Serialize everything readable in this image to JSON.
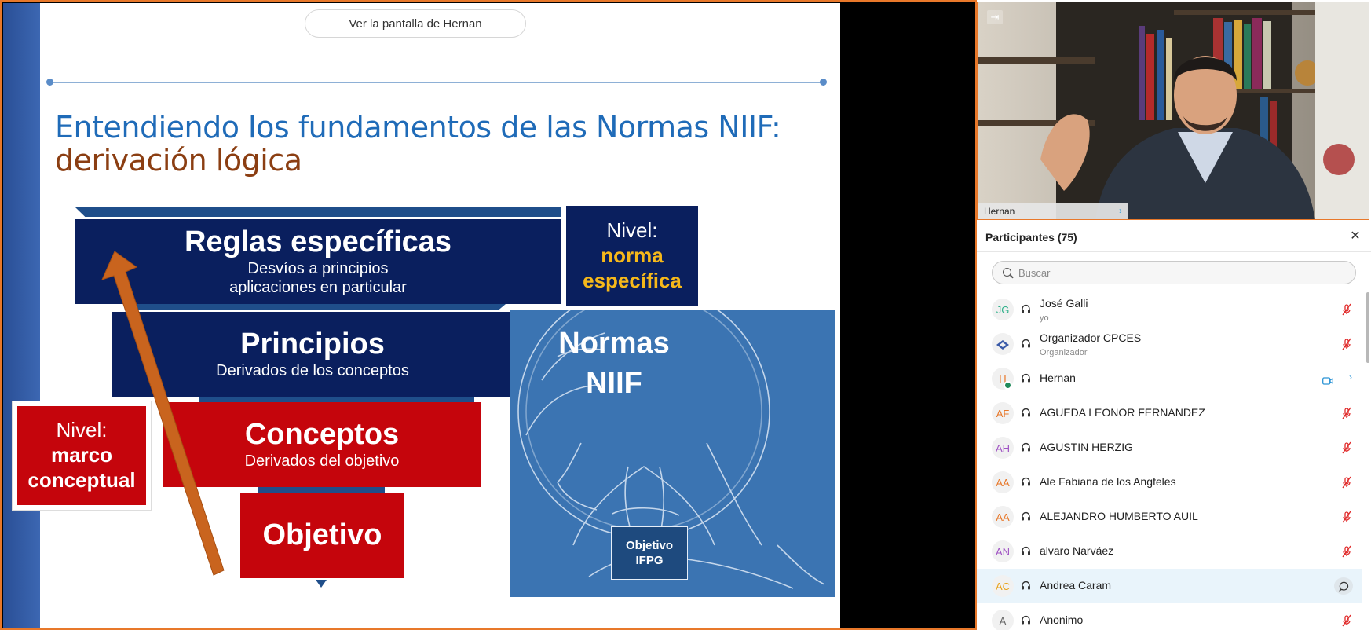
{
  "share": {
    "view_pill": "Ver la pantalla de Hernan"
  },
  "slide": {
    "title_line1": "Entendiendo los fundamentos de las Normas NIIF:",
    "title_line2": "derivación lógica",
    "reglas": {
      "title": "Reglas específicas",
      "sub1": "Desvíos a principios",
      "sub2": "aplicaciones en particular"
    },
    "principios": {
      "title": "Principios",
      "sub": "Derivados de los conceptos"
    },
    "conceptos": {
      "title": "Conceptos",
      "sub": "Derivados del objetivo"
    },
    "objetivo": {
      "title": "Objetivo"
    },
    "nivel_norma": {
      "line1": "Nivel:",
      "line2": "norma",
      "line3": "específica"
    },
    "nivel_marco": {
      "line1": "Nivel:",
      "line2": "marco",
      "line3": "conceptual"
    },
    "niif": {
      "line1": "Normas",
      "line2": "NIIF"
    },
    "objetivo_ifpg": {
      "line1": "Objetivo",
      "line2": "IFPG"
    },
    "colors": {
      "navy": "#0a1f5e",
      "red": "#c5050c",
      "title_blue": "#1f6bb8",
      "title_brown": "#8b3e12",
      "highlight": "#f6b81a",
      "arrow": "#c9641e"
    }
  },
  "video": {
    "speaker_name": "Hernan",
    "collapse_icon": "collapse-right-icon"
  },
  "participants": {
    "title": "Participantes (75)",
    "search_placeholder": "Buscar",
    "items": [
      {
        "initials": "JG",
        "name": "José Galli",
        "role": "yo",
        "color": "#2fb08a",
        "status": "muted"
      },
      {
        "initials": "",
        "name": "Organizador CPCES",
        "role": "Organizador",
        "color": "#3a5aa8",
        "status": "muted"
      },
      {
        "initials": "H",
        "name": "Hernan",
        "role": "",
        "color": "#e8782a",
        "status": "video"
      },
      {
        "initials": "AF",
        "name": "AGUEDA LEONOR FERNANDEZ",
        "role": "",
        "color": "#e8782a",
        "status": "muted"
      },
      {
        "initials": "AH",
        "name": "AGUSTIN HERZIG",
        "role": "",
        "color": "#a054c4",
        "status": "muted"
      },
      {
        "initials": "AA",
        "name": "Ale Fabiana de los Angfeles",
        "role": "",
        "color": "#e8782a",
        "status": "muted"
      },
      {
        "initials": "AA",
        "name": "ALEJANDRO HUMBERTO AUIL",
        "role": "",
        "color": "#e8782a",
        "status": "muted"
      },
      {
        "initials": "AN",
        "name": "alvaro Narváez",
        "role": "",
        "color": "#a054c4",
        "status": "muted"
      },
      {
        "initials": "AC",
        "name": "Andrea Caram",
        "role": "",
        "color": "#e8a21a",
        "status": "chat"
      },
      {
        "initials": "A",
        "name": "Anonimo",
        "role": "",
        "color": "#666666",
        "status": "muted"
      }
    ]
  }
}
